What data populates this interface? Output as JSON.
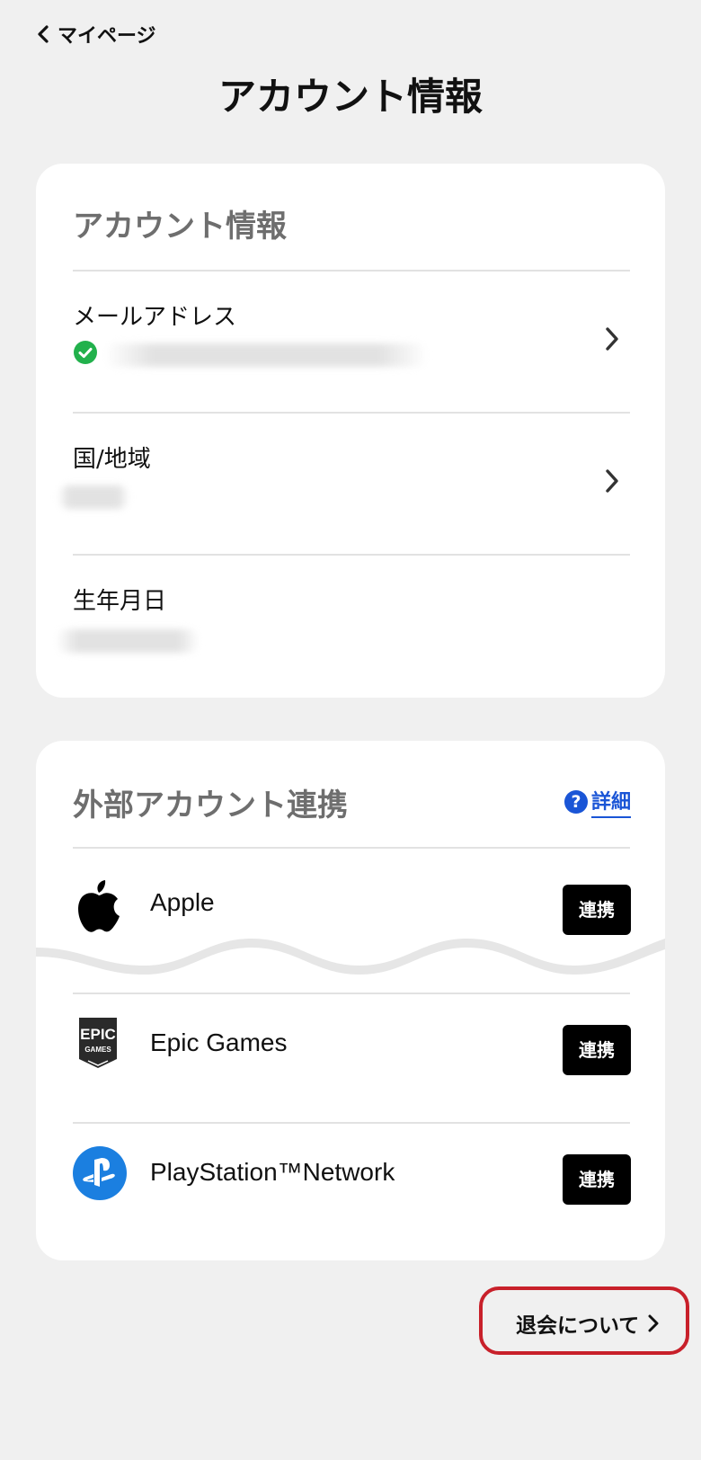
{
  "nav": {
    "back_label": "マイページ"
  },
  "page": {
    "title": "アカウント情報"
  },
  "account": {
    "title": "アカウント情報",
    "rows": [
      {
        "label": "メールアドレス",
        "verified": true
      },
      {
        "label": "国/地域"
      },
      {
        "label": "生年月日"
      }
    ]
  },
  "external": {
    "title": "外部アカウント連携",
    "help_label": "詳細",
    "services": [
      {
        "name": "Apple",
        "button": "連携"
      },
      {
        "name": "Epic Games",
        "button": "連携"
      },
      {
        "name": "PlayStation™Network",
        "button": "連携"
      }
    ],
    "epic_logo_text": "EPIC",
    "epic_logo_subtext": "GAMES"
  },
  "leave": {
    "label": "退会について"
  },
  "colors": {
    "background": "#f0f0f0",
    "card": "#ffffff",
    "accent_link": "#1a55d6",
    "verified_green": "#22b14c",
    "highlight_red": "#c8202a",
    "playstation_blue": "#1b7fe0"
  }
}
